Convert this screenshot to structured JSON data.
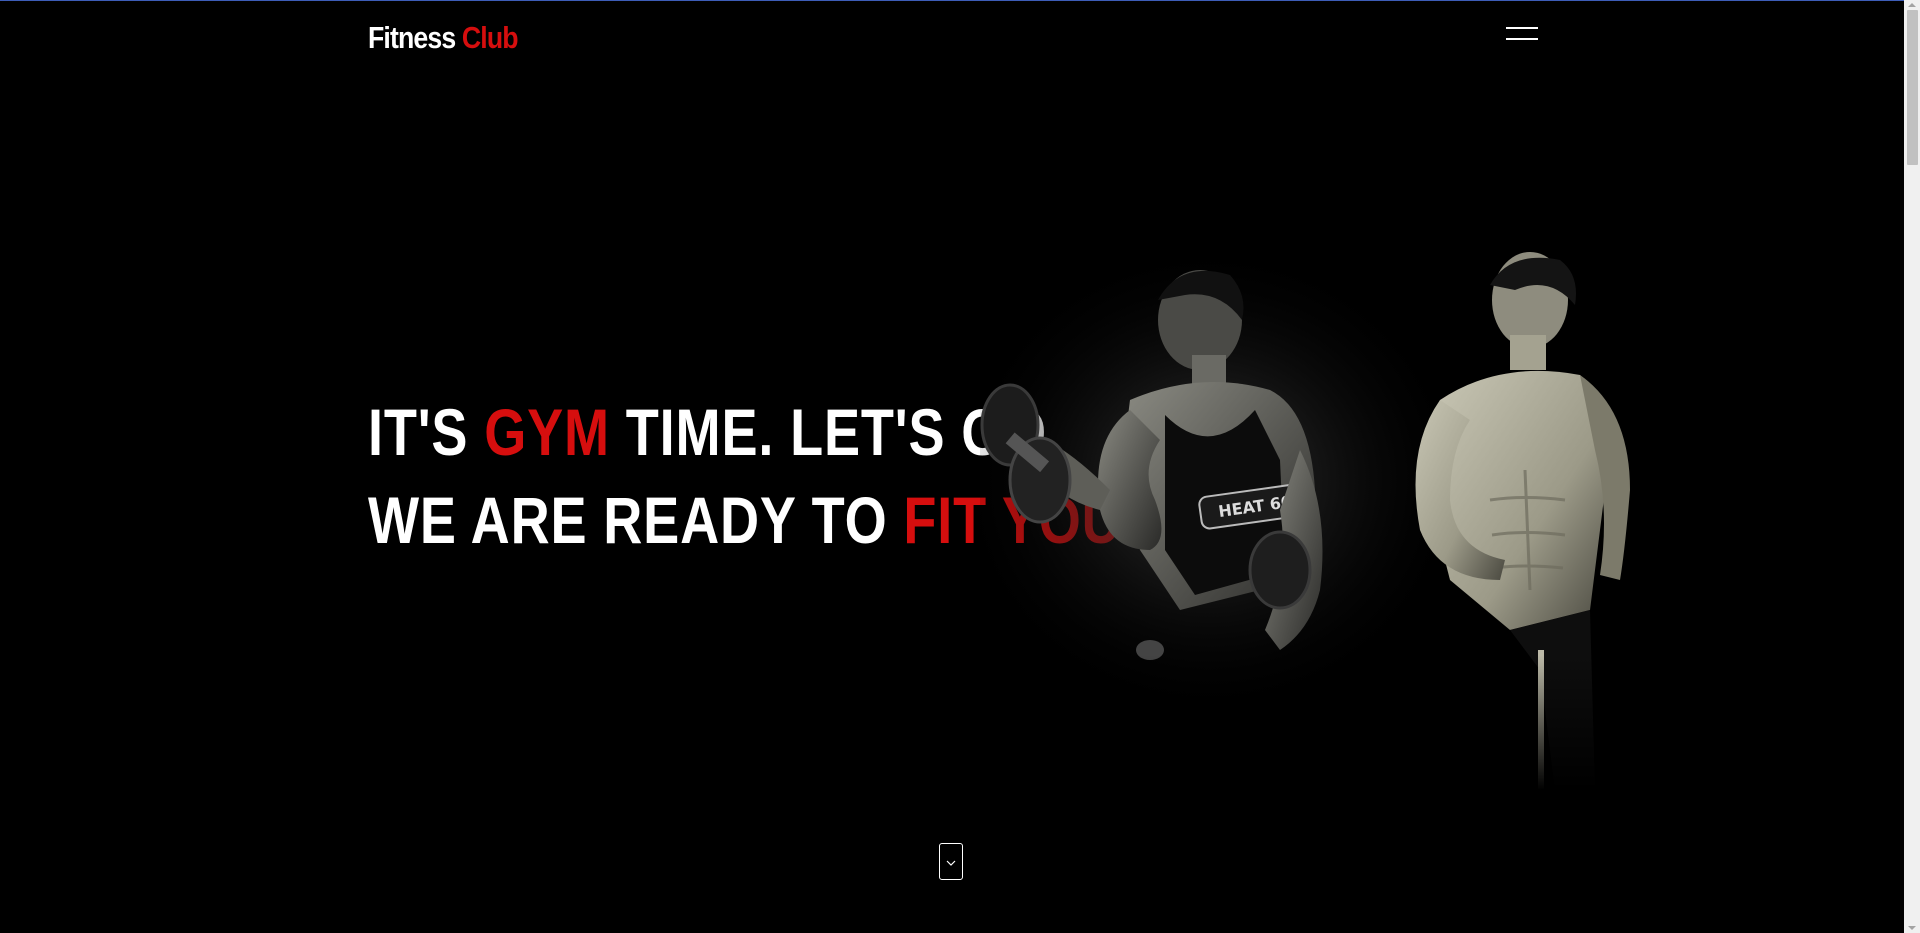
{
  "brand": {
    "name_part1": "Fitness ",
    "name_part2": "Club",
    "accent_color": "#d60e0e"
  },
  "nav": {
    "menu_icon": "hamburger-menu-icon"
  },
  "hero": {
    "line1": {
      "before": "IT'S ",
      "highlight": "GYM",
      "after": " TIME. LET'S GO"
    },
    "line2": {
      "before": "WE ARE READY TO ",
      "highlight": "FIT YOU"
    },
    "image_alt": "two muscular men, one lifting a dumbbell"
  },
  "scroll_button": {
    "icon": "chevron-down-icon"
  },
  "colors": {
    "background": "#000000",
    "text": "#ffffff",
    "accent": "#d60e0e"
  }
}
